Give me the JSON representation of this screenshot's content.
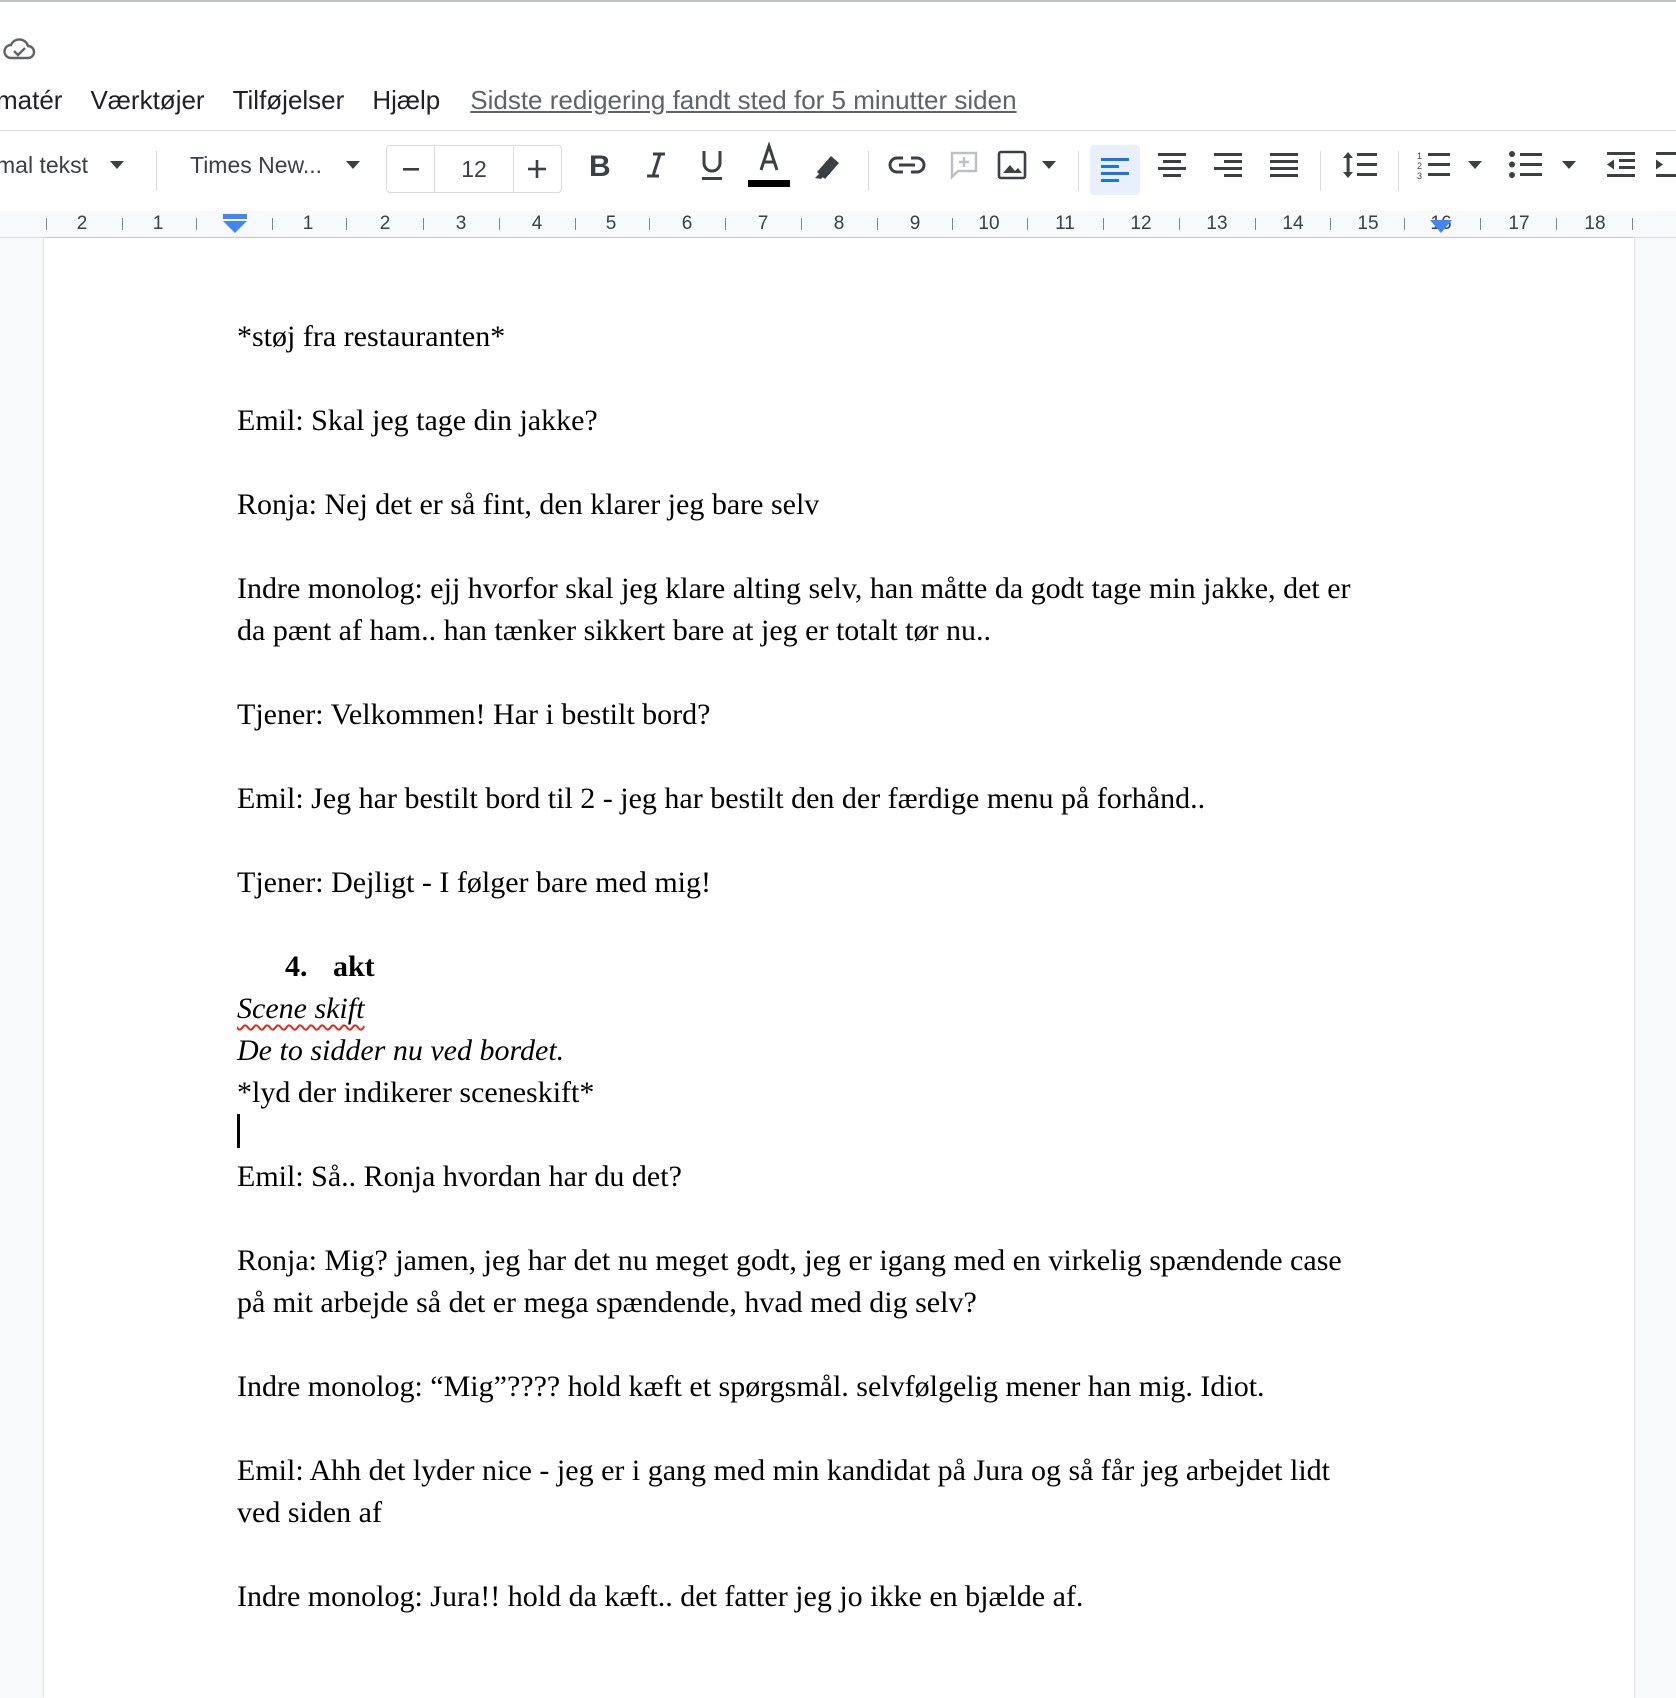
{
  "header": {
    "cloud_icon": "cloud-check-icon",
    "menu": [
      "matér",
      "Værktøjer",
      "Tilføjelser",
      "Hjælp"
    ],
    "last_edit": "Sidste redigering fandt sted for 5 minutter siden"
  },
  "toolbar": {
    "style": "mal tekst",
    "font": "Times New...",
    "font_size": "12",
    "minus": "−",
    "plus": "+",
    "text_color": "#000000",
    "accent": "#1a73e8"
  },
  "ruler": {
    "labels": [
      "2",
      "1",
      "1",
      "2",
      "3",
      "4",
      "5",
      "6",
      "7",
      "8",
      "9",
      "10",
      "11",
      "12",
      "13",
      "14",
      "15",
      "16",
      "17",
      "18"
    ]
  },
  "document": {
    "lines": {
      "l01": "*støj fra restauranten*",
      "l02": "Emil: Skal jeg tage din jakke?",
      "l03": "Ronja: Nej det er så fint, den klarer jeg bare selv",
      "l04": "Indre monolog: ejj hvorfor skal jeg klare alting selv, han måtte da godt tage min jakke, det er",
      "l05": "da pænt af ham.. han tænker sikkert bare at jeg er totalt tør nu..",
      "l06": "Tjener: Velkommen! Har i bestilt bord?",
      "l07": "Emil: Jeg har bestilt bord til 2 - jeg har bestilt den der færdige menu på forhånd..",
      "l08": "Tjener: Dejligt - I følger bare med mig!",
      "heading_num": "4.",
      "heading_text": "akt",
      "l09": "Scene skift",
      "l10": "De to sidder nu ved bordet.",
      "l11": "*lyd der indikerer sceneskift*",
      "l12": "Emil: Så.. Ronja hvordan har du det?",
      "l13": "Ronja: Mig? jamen, jeg har det nu meget godt, jeg er igang med en virkelig spændende case",
      "l14": "på mit arbejde så det er mega spændende, hvad med dig selv?",
      "l15": "Indre monolog: “Mig”???? hold kæft et spørgsmål. selvfølgelig mener han mig. Idiot.",
      "l16": "Emil: Ahh det lyder nice - jeg er i gang med min kandidat på Jura og så får jeg arbejdet lidt",
      "l17": "ved siden af",
      "l18": "Indre monolog: Jura!! hold da kæft.. det fatter jeg jo ikke en bjælde af."
    }
  }
}
